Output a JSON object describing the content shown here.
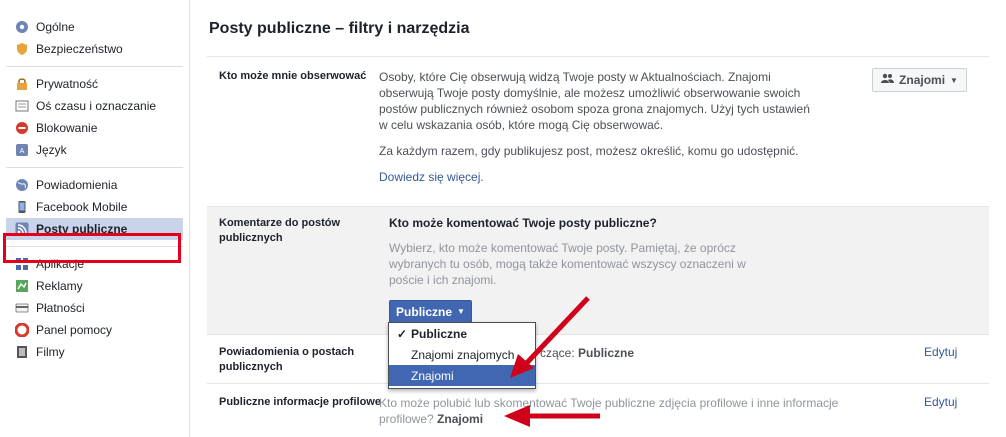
{
  "sidebar": {
    "groups": [
      [
        {
          "label": "Ogólne",
          "icon": "gear-icon"
        },
        {
          "label": "Bezpieczeństwo",
          "icon": "shield-icon"
        }
      ],
      [
        {
          "label": "Prywatność",
          "icon": "lock-icon"
        },
        {
          "label": "Oś czasu i oznaczanie",
          "icon": "timeline-icon"
        },
        {
          "label": "Blokowanie",
          "icon": "block-icon"
        },
        {
          "label": "Język",
          "icon": "language-icon"
        }
      ],
      [
        {
          "label": "Powiadomienia",
          "icon": "globe-icon"
        },
        {
          "label": "Facebook Mobile",
          "icon": "mobile-icon"
        },
        {
          "label": "Posty publiczne",
          "icon": "rss-icon"
        }
      ],
      [
        {
          "label": "Aplikacje",
          "icon": "apps-icon"
        },
        {
          "label": "Reklamy",
          "icon": "ads-icon"
        },
        {
          "label": "Płatności",
          "icon": "card-icon"
        },
        {
          "label": "Panel pomocy",
          "icon": "lifebuoy-icon"
        },
        {
          "label": "Filmy",
          "icon": "film-icon"
        }
      ]
    ]
  },
  "main": {
    "title": "Posty publiczne – filtry i narzędzia",
    "follow": {
      "label": "Kto może mnie obserwować",
      "desc": "Osoby, które Cię obserwują widzą Twoje posty w Aktualnościach. Znajomi obserwują Twoje posty domyślnie, ale możesz umożliwić obserwowanie swoich postów publicznych również osobom spoza grona znajomych. Użyj tych ustawień w celu wskazania osób, które mogą Cię obserwować.",
      "note": "Za każdym razem, gdy publikujesz post, możesz określić, komu go udostępnić.",
      "learn_more": "Dowiedz się więcej.",
      "button": "Znajomi"
    },
    "comments": {
      "label": "Komentarze do postów publicznych",
      "question": "Kto może komentować Twoje posty publiczne?",
      "desc": "Wybierz, kto może komentować Twoje posty. Pamiętaj, że oprócz wybranych tu osób, mogą także komentować wszyscy oznaczeni w poście i ich znajomi.",
      "button": "Publiczne",
      "options": [
        "Publiczne",
        "Znajomi znajomych",
        "Znajomi"
      ],
      "checked": "Publiczne",
      "hovered": "Znajomi"
    },
    "notifications": {
      "label": "Powiadomienia o postach publicznych",
      "value_prefix": "czące:",
      "value": "Publiczne",
      "edit": "Edytuj"
    },
    "profile": {
      "label": "Publiczne informacje profilowe",
      "text": "Kto może polubić lub skomentować Twoje publiczne zdjęcia profilowe i inne informacje profilowe?",
      "value": "Znajomi",
      "edit": "Edytuj"
    }
  },
  "colors": {
    "accent": "#4267b2",
    "highlight": "#e2001a",
    "arrow": "#d0021b"
  }
}
